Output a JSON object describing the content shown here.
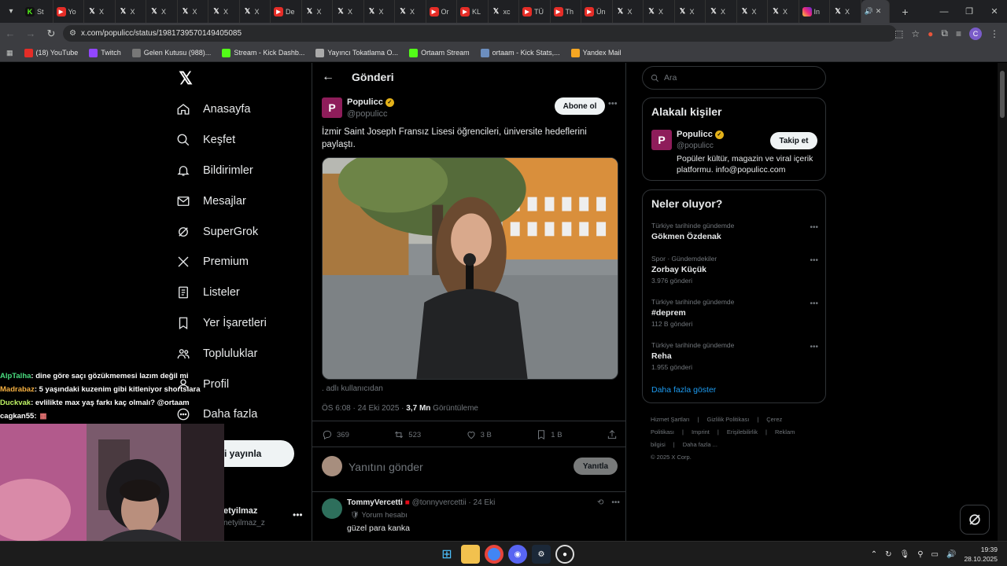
{
  "browser": {
    "tabs": [
      {
        "icon": "kick",
        "label": "St"
      },
      {
        "icon": "youtube",
        "label": "Yo"
      },
      {
        "icon": "x",
        "label": "X"
      },
      {
        "icon": "x",
        "label": "X"
      },
      {
        "icon": "x",
        "label": "X"
      },
      {
        "icon": "x",
        "label": "X"
      },
      {
        "icon": "x",
        "label": "X"
      },
      {
        "icon": "x",
        "label": "X"
      },
      {
        "icon": "youtube",
        "label": "De"
      },
      {
        "icon": "x",
        "label": "X"
      },
      {
        "icon": "x",
        "label": "X"
      },
      {
        "icon": "x",
        "label": "X"
      },
      {
        "icon": "x",
        "label": "X"
      },
      {
        "icon": "youtube",
        "label": "Or"
      },
      {
        "icon": "youtube",
        "label": "KL"
      },
      {
        "icon": "x",
        "label": "xc"
      },
      {
        "icon": "youtube",
        "label": "TÜ"
      },
      {
        "icon": "youtube",
        "label": "Th"
      },
      {
        "icon": "youtube",
        "label": "Ün"
      },
      {
        "icon": "x",
        "label": "X"
      },
      {
        "icon": "x",
        "label": "X"
      },
      {
        "icon": "x",
        "label": "X"
      },
      {
        "icon": "x",
        "label": "X"
      },
      {
        "icon": "x",
        "label": "X"
      },
      {
        "icon": "x",
        "label": "X"
      },
      {
        "icon": "instagram",
        "label": "In"
      },
      {
        "icon": "x",
        "label": "X"
      }
    ],
    "url": "x.com/populicc/status/1981739570149405085",
    "bookmarks": [
      {
        "label": "(18) YouTube",
        "color": "#e52d27"
      },
      {
        "label": "Twitch",
        "color": "#9146ff"
      },
      {
        "label": "Gelen Kutusu (988)...",
        "color": "#777"
      },
      {
        "label": "Stream - Kick Dashb...",
        "color": "#53fc18"
      },
      {
        "label": "Yayıncı Tokatlama O...",
        "color": "#aaa"
      },
      {
        "label": "Ortaam Stream",
        "color": "#53fc18"
      },
      {
        "label": "ortaam - Kick Stats,...",
        "color": "#6c8ebf"
      },
      {
        "label": "Yandex Mail",
        "color": "#f5a623"
      }
    ],
    "profile_initial": "C"
  },
  "sidebar": {
    "items": [
      {
        "label": "Anasayfa",
        "icon": "home-icon"
      },
      {
        "label": "Keşfet",
        "icon": "search-icon"
      },
      {
        "label": "Bildirimler",
        "icon": "bell-icon"
      },
      {
        "label": "Mesajlar",
        "icon": "mail-icon"
      },
      {
        "label": "SuperGrok",
        "icon": "grok-icon"
      },
      {
        "label": "Premium",
        "icon": "x-icon"
      },
      {
        "label": "Listeler",
        "icon": "list-icon"
      },
      {
        "label": "Yer İşaretleri",
        "icon": "bookmark-icon"
      },
      {
        "label": "Topluluklar",
        "icon": "people-icon"
      },
      {
        "label": "Profil",
        "icon": "user-icon"
      },
      {
        "label": "Daha fazla",
        "icon": "more-circle-icon"
      }
    ],
    "post_button": "eri yayınla",
    "account_name": "etyilmaz",
    "account_handle": "netyilmaz_z"
  },
  "post": {
    "header_title": "Gönderi",
    "author_name": "Populicc",
    "author_handle": "@populicc",
    "avatar_letter": "P",
    "subscribe_label": "Abone ol",
    "text": "İzmir Saint Joseph Fransız Lisesi öğrencileri, üniversite hedeflerini paylaştı.",
    "media_caption": ". adlı kullanıcıdan",
    "time": "ÖS 6:08 · 24 Eki 2025 · ",
    "views_count": "3,7 Mn",
    "views_label": " Görüntüleme",
    "replies": "369",
    "reposts": "523",
    "likes": "3 B",
    "bookmarks": "1 B",
    "reply_placeholder": "Yanıtını gönder",
    "reply_button": "Yanıtla"
  },
  "reply": {
    "name": "TommyVercetti",
    "handle": "@tonnyvercettii",
    "date": "· 24 Eki",
    "badge_text": "Yorum hesabı",
    "text": "güzel para kanka"
  },
  "right": {
    "search_placeholder": "Ara",
    "related_title": "Alakalı kişiler",
    "related_name": "Populicc",
    "related_handle": "@populicc",
    "related_bio": "Popüler kültür, magazin ve viral içerik platformu. info@populicc.com",
    "follow_label": "Takip et",
    "trends_title": "Neler oluyor?",
    "trends": [
      {
        "context": "Türkiye tarihinde gündemde",
        "title": "Gökmen Özdenak",
        "count": ""
      },
      {
        "context": "Spor · Gündemdekiler",
        "title": "Zorbay Küçük",
        "count": "3.976 gönderi"
      },
      {
        "context": "Türkiye tarihinde gündemde",
        "title": "#deprem",
        "count": "112 B gönderi"
      },
      {
        "context": "Türkiye tarihinde gündemde",
        "title": "Reha",
        "count": "1.955 gönderi"
      }
    ],
    "show_more": "Daha fazla göster",
    "footer_links": [
      "Hizmet Şartları",
      "|",
      "Gizlilik Politikası",
      "|",
      "Çerez Politikası",
      "|",
      "Imprint",
      "|",
      "Erişilebilirlik",
      "|",
      "Reklam bilgisi",
      "|",
      "Daha fazla ..."
    ],
    "copyright": "© 2025 X Corp."
  },
  "chat": [
    {
      "user": "AlpTalha",
      "color": "#4ade80",
      "text": ": dine göre saçı gözükmemesi lazım değil mi"
    },
    {
      "user": "Madrabaz",
      "color": "#f5b041",
      "text": ": 5 yaşındaki kuzenim gibi kitleniyor shortslara"
    },
    {
      "user": "Duckvak",
      "color": "#bef264",
      "text": ": evlilikte max yaş farkı kaç olmalı? @ortaam"
    },
    {
      "user": "cagkan55",
      "color": "#ffffff",
      "text": ":"
    }
  ],
  "taskbar": {
    "time": "19:39",
    "date": "28.10.2025"
  }
}
